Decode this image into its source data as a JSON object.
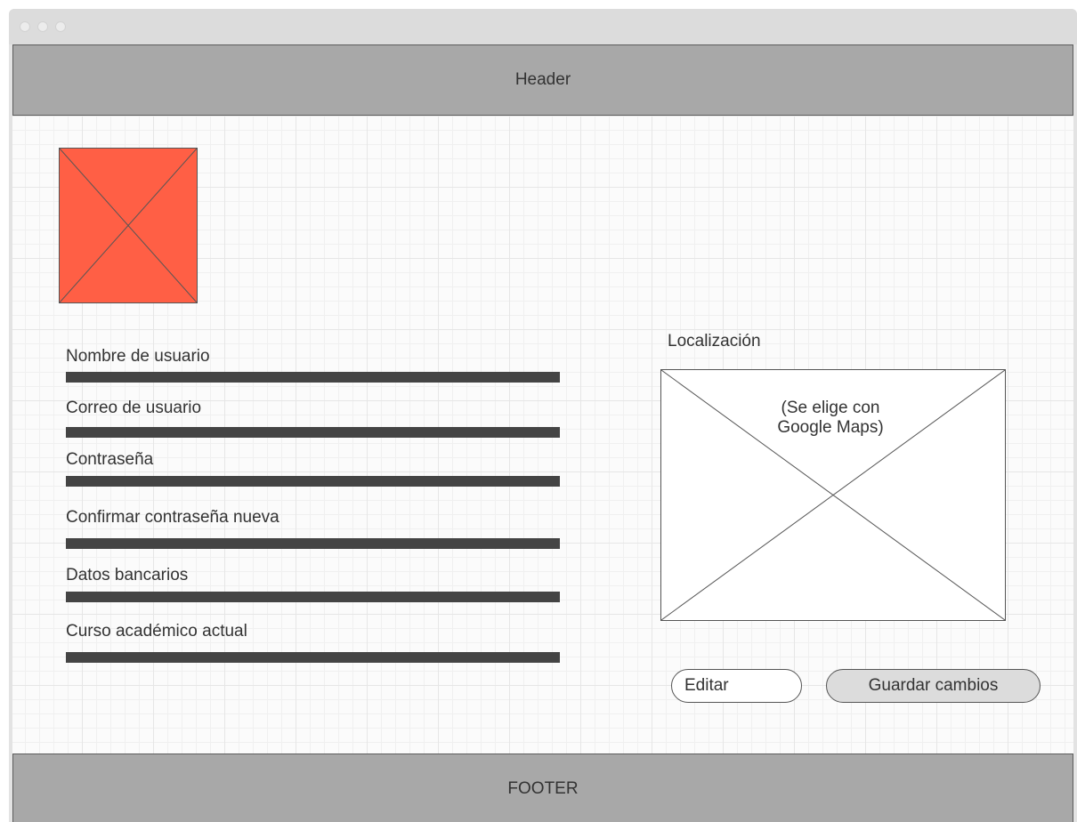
{
  "header": {
    "label": "Header"
  },
  "footer": {
    "label": "FOOTER"
  },
  "avatar": {
    "icon": "image-placeholder-icon",
    "color": "#ff5f45"
  },
  "form": {
    "fields": [
      {
        "label": "Nombre de usuario"
      },
      {
        "label": "Correo de usuario"
      },
      {
        "label": "Contraseña"
      },
      {
        "label": "Confirmar contraseña nueva"
      },
      {
        "label": "Datos bancarios"
      },
      {
        "label": "Curso académico actual"
      }
    ]
  },
  "location": {
    "label": "Localización",
    "note_line1": "(Se elige con",
    "note_line2": "Google Maps)",
    "icon": "map-placeholder-icon"
  },
  "actions": {
    "edit_label": "Editar",
    "save_label": "Guardar cambios"
  }
}
